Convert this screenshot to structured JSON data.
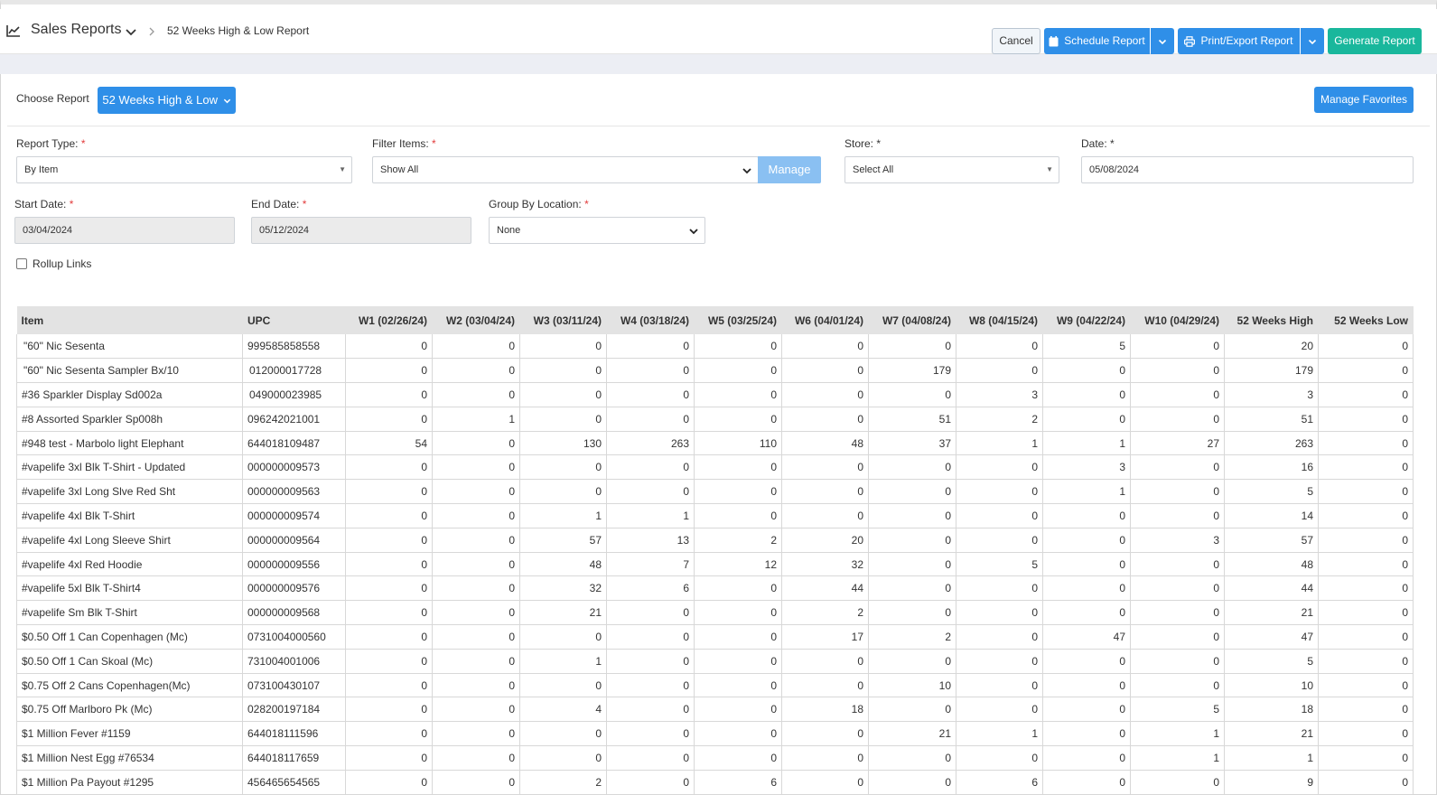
{
  "header": {
    "title": "Sales Reports",
    "breadcrumb": "52 Weeks High & Low Report",
    "cancel_label": "Cancel",
    "schedule_label": "Schedule Report",
    "print_label": "Print/Export Report",
    "generate_label": "Generate Report"
  },
  "choose": {
    "label": "Choose Report",
    "selected": "52 Weeks High & Low",
    "favorites_label": "Manage Favorites"
  },
  "form": {
    "report_type": {
      "label": "Report Type:",
      "value": "By Item"
    },
    "filter_items": {
      "label": "Filter Items:",
      "value": "Show All",
      "manage_label": "Manage"
    },
    "store": {
      "label": "Store:",
      "value": "Select All"
    },
    "date": {
      "label": "Date:",
      "value": "05/08/2024"
    },
    "start_date": {
      "label": "Start Date:",
      "value": "03/04/2024"
    },
    "end_date": {
      "label": "End Date:",
      "value": "05/12/2024"
    },
    "group_by": {
      "label": "Group By Location:",
      "value": "None"
    },
    "rollup_label": "Rollup Links",
    "required_mark": "*"
  },
  "colors": {
    "primary": "#2f8fe8",
    "success": "#19b79c",
    "required": "#e23b3b"
  },
  "table": {
    "columns": [
      "Item",
      "UPC",
      "W1 (02/26/24)",
      "W2 (03/04/24)",
      "W3 (03/11/24)",
      "W4 (03/18/24)",
      "W5 (03/25/24)",
      "W6 (04/01/24)",
      "W7 (04/08/24)",
      "W8 (04/15/24)",
      "W9 (04/22/24)",
      "W10 (04/29/24)",
      "52 Weeks High",
      "52 Weeks Low"
    ],
    "rows": [
      [
        "\"60\" Nic Sesenta",
        "999585858558",
        "0",
        "0",
        "0",
        "0",
        "0",
        "0",
        "0",
        "0",
        "5",
        "0",
        "20",
        "0"
      ],
      [
        "\"60\" Nic Sesenta Sampler Bx/10",
        "012000017728",
        "0",
        "0",
        "0",
        "0",
        "0",
        "0",
        "179",
        "0",
        "0",
        "0",
        "179",
        "0"
      ],
      [
        "#36 Sparkler Display Sd002a",
        "049000023985",
        "0",
        "0",
        "0",
        "0",
        "0",
        "0",
        "0",
        "3",
        "0",
        "0",
        "3",
        "0"
      ],
      [
        "#8 Assorted Sparkler Sp008h",
        "096242021001",
        "0",
        "1",
        "0",
        "0",
        "0",
        "0",
        "51",
        "2",
        "0",
        "0",
        "51",
        "0"
      ],
      [
        "#948 test - Marbolo light Elephant",
        "644018109487",
        "54",
        "0",
        "130",
        "263",
        "110",
        "48",
        "37",
        "1",
        "1",
        "27",
        "263",
        "0"
      ],
      [
        "#vapelife 3xl Blk T-Shirt - Updated",
        "000000009573",
        "0",
        "0",
        "0",
        "0",
        "0",
        "0",
        "0",
        "0",
        "3",
        "0",
        "16",
        "0"
      ],
      [
        "#vapelife 3xl Long Slve Red Sht",
        "000000009563",
        "0",
        "0",
        "0",
        "0",
        "0",
        "0",
        "0",
        "0",
        "1",
        "0",
        "5",
        "0"
      ],
      [
        "#vapelife 4xl Blk T-Shirt",
        "000000009574",
        "0",
        "0",
        "1",
        "1",
        "0",
        "0",
        "0",
        "0",
        "0",
        "0",
        "14",
        "0"
      ],
      [
        "#vapelife 4xl Long Sleeve Shirt",
        "000000009564",
        "0",
        "0",
        "57",
        "13",
        "2",
        "20",
        "0",
        "0",
        "0",
        "3",
        "57",
        "0"
      ],
      [
        "#vapelife 4xl Red Hoodie",
        "000000009556",
        "0",
        "0",
        "48",
        "7",
        "12",
        "32",
        "0",
        "5",
        "0",
        "0",
        "48",
        "0"
      ],
      [
        "#vapelife 5xl Blk T-Shirt4",
        "000000009576",
        "0",
        "0",
        "32",
        "6",
        "0",
        "44",
        "0",
        "0",
        "0",
        "0",
        "44",
        "0"
      ],
      [
        "#vapelife Sm Blk T-Shirt",
        "000000009568",
        "0",
        "0",
        "21",
        "0",
        "0",
        "2",
        "0",
        "0",
        "0",
        "0",
        "21",
        "0"
      ],
      [
        "$0.50 Off 1 Can Copenhagen (Mc)",
        "0731004000560",
        "0",
        "0",
        "0",
        "0",
        "0",
        "17",
        "2",
        "0",
        "47",
        "0",
        "47",
        "0"
      ],
      [
        "$0.50 Off 1 Can Skoal (Mc)",
        "731004001006",
        "0",
        "0",
        "1",
        "0",
        "0",
        "0",
        "0",
        "0",
        "0",
        "0",
        "5",
        "0"
      ],
      [
        "$0.75 Off 2 Cans Copenhagen(Mc)",
        "073100430107",
        "0",
        "0",
        "0",
        "0",
        "0",
        "0",
        "10",
        "0",
        "0",
        "0",
        "10",
        "0"
      ],
      [
        "$0.75 Off Marlboro Pk (Mc)",
        "028200197184",
        "0",
        "0",
        "4",
        "0",
        "0",
        "18",
        "0",
        "0",
        "0",
        "5",
        "18",
        "0"
      ],
      [
        "$1 Million Fever #1159",
        "644018111596",
        "0",
        "0",
        "0",
        "0",
        "0",
        "0",
        "21",
        "1",
        "0",
        "1",
        "21",
        "0"
      ],
      [
        "$1 Million Nest Egg #76534",
        "644018117659",
        "0",
        "0",
        "0",
        "0",
        "0",
        "0",
        "0",
        "0",
        "0",
        "1",
        "1",
        "0"
      ],
      [
        "$1 Million Pa Payout #1295",
        "456465654565",
        "0",
        "0",
        "2",
        "0",
        "6",
        "0",
        "0",
        "6",
        "0",
        "0",
        "9",
        "0"
      ]
    ]
  }
}
